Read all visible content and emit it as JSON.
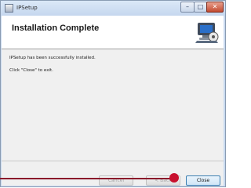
{
  "window": {
    "title": "IPSetup",
    "icon": "setup-icon",
    "controls": {
      "minimize_icon": "minimize-icon",
      "maximize_icon": "maximize-icon",
      "close_icon": "close-icon"
    }
  },
  "header": {
    "title": "Installation Complete",
    "icon": "computer-setup-icon"
  },
  "body": {
    "message": "IPSetup has been successfully installed.",
    "instruction": "Click \"Close\" to exit."
  },
  "buttons": {
    "cancel_label": "Cancel",
    "back_label": "< Back",
    "close_label": "Close"
  },
  "colors": {
    "titlebar": "#c9daf0",
    "close_button": "#c24a30",
    "pointer": "#c8102e"
  }
}
